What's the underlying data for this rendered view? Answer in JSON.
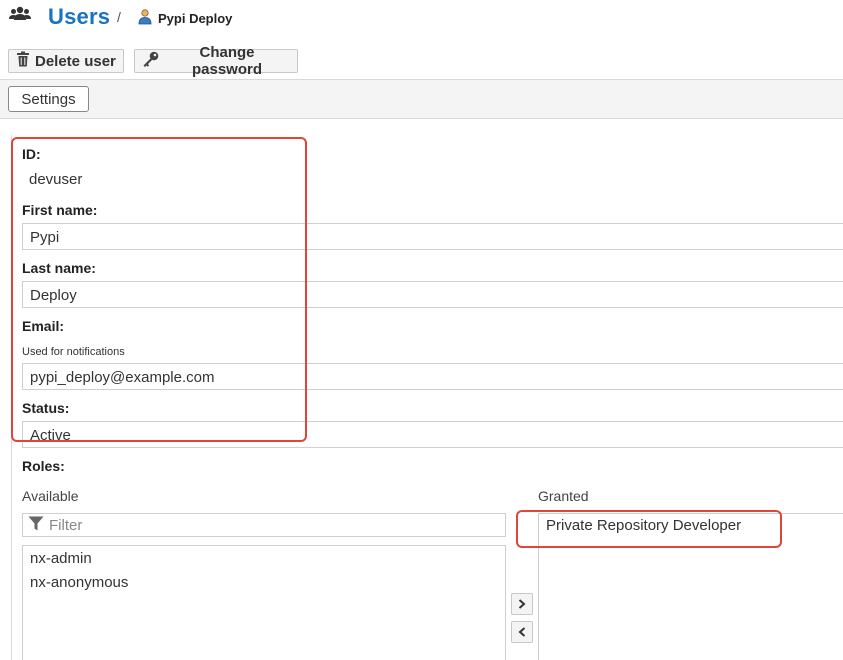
{
  "header": {
    "title": "Users",
    "separator": "/",
    "breadcrumb_user": "Pypi Deploy"
  },
  "toolbar": {
    "delete_label": "Delete user",
    "password_label": "Change password"
  },
  "tabs": {
    "settings": "Settings"
  },
  "form": {
    "id_label": "ID:",
    "id_value": "devuser",
    "first_name_label": "First name:",
    "first_name_value": "Pypi",
    "last_name_label": "Last name:",
    "last_name_value": "Deploy",
    "email_label": "Email:",
    "email_help": "Used for notifications",
    "email_value": "pypi_deploy@example.com",
    "status_label": "Status:",
    "status_value": "Active"
  },
  "roles": {
    "label": "Roles:",
    "available_label": "Available",
    "granted_label": "Granted",
    "filter_placeholder": "Filter",
    "available": [
      "nx-admin",
      "nx-anonymous"
    ],
    "granted": [
      "Private Repository Developer"
    ]
  },
  "colors": {
    "accent": "#1a73c0",
    "highlight": "#e0453a"
  }
}
